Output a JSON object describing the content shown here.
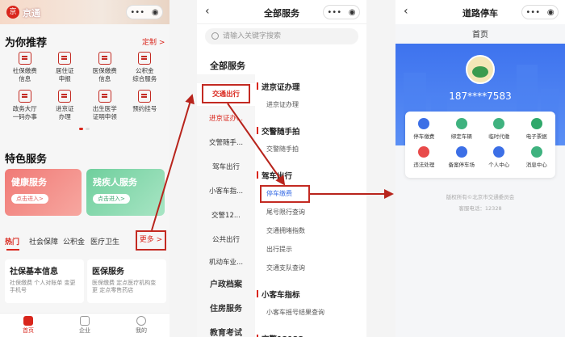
{
  "screen1": {
    "app_name": "京通",
    "logo": "京",
    "recommend_title": "为你推荐",
    "customize_label": "定制 >",
    "recommend_items": [
      {
        "label": "社保缴费\n信息",
        "icon": "doc-icon"
      },
      {
        "label": "居住证\n申报",
        "icon": "id-card-icon"
      },
      {
        "label": "医保缴费\n信息",
        "icon": "doc-icon"
      },
      {
        "label": "公积金\n综合服务",
        "icon": "house-icon"
      },
      {
        "label": "政务大厅\n一码办事",
        "icon": "building-icon"
      },
      {
        "label": "进京证\n办理",
        "icon": "doc-icon"
      },
      {
        "label": "出生医学\n证明申领",
        "icon": "doc-icon"
      },
      {
        "label": "预约挂号",
        "icon": "calendar-icon"
      }
    ],
    "feature_title": "特色服务",
    "feature_cards": [
      {
        "title": "健康服务",
        "button": "点击进入>",
        "color": "#ee6f6f"
      },
      {
        "title": "残疾人服务",
        "button": "点击进入>",
        "color": "#7cd3a6"
      }
    ],
    "tabs": [
      "热门",
      "社会保障",
      "公积金",
      "医疗卫生"
    ],
    "more_label": "更多 >",
    "info_cards": [
      {
        "title": "社保基本信息",
        "sub": "社保缴费 个人对账单 变更手机号"
      },
      {
        "title": "医保服务",
        "sub": "医保缴费 定点医疗机构变更 定点零售药店"
      }
    ],
    "bottom_nav": [
      "首页",
      "企业",
      "我的"
    ]
  },
  "screen2": {
    "title": "全部服务",
    "search_placeholder": "请输入关键字搜索",
    "all_label": "全部服务",
    "left_items": [
      "交通出行",
      "进京证办...",
      "交警随手...",
      "驾车出行",
      "小客车指...",
      "交警12...",
      "公共出行",
      "机动车业...",
      "户政档案",
      "住房服务",
      "教育考试"
    ],
    "groups": [
      {
        "heading": "进京证办理",
        "items": [
          "进京证办理"
        ]
      },
      {
        "heading": "交警随手拍",
        "items": [
          "交警随手拍"
        ]
      },
      {
        "heading": "驾车出行",
        "items": [
          "停车缴费",
          "尾号限行查询",
          "交通拥堵指数",
          "出行提示",
          "交通支队查询"
        ]
      },
      {
        "heading": "小客车指标",
        "items": [
          "小客车摇号结果查询"
        ]
      },
      {
        "heading": "交警12123",
        "items": []
      }
    ]
  },
  "screen3": {
    "title": "道路停车",
    "home_label": "首页",
    "phone": "187****7583",
    "services": [
      {
        "label": "停车缴费",
        "color": "#3c6fe6"
      },
      {
        "label": "绑定车辆",
        "color": "#3fb27f"
      },
      {
        "label": "临时代缴",
        "color": "#3fb27f"
      },
      {
        "label": "电子票据",
        "color": "#2fa86a"
      },
      {
        "label": "违法处理",
        "color": "#e84a4a"
      },
      {
        "label": "备案停车场",
        "color": "#3c6fe6"
      },
      {
        "label": "个人中心",
        "color": "#3c6fe6"
      },
      {
        "label": "消息中心",
        "color": "#3fb27f"
      }
    ],
    "copyright": "版权所有©北京市交通委员会",
    "hotline": "客服电话：12328"
  }
}
